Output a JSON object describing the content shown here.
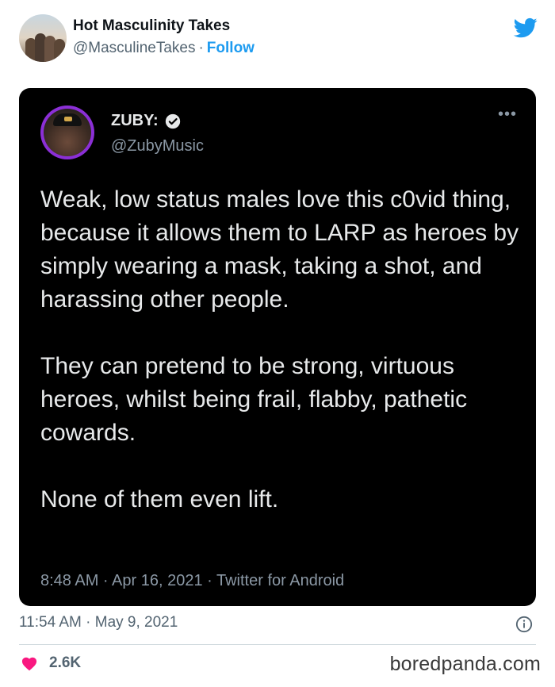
{
  "author": {
    "name": "Hot Masculinity Takes",
    "handle": "@MasculineTakes",
    "separator": "·",
    "follow_label": "Follow"
  },
  "quoted_tweet": {
    "name": "ZUBY:",
    "handle": "@ZubyMusic",
    "more_label": "•••",
    "paragraphs": [
      "Weak, low status males love this c0vid thing, because it allows them to LARP as heroes by simply wearing a mask, taking a shot, and harassing other people.",
      "They can pretend to be strong, virtuous heroes, whilst being frail, flabby, pathetic cowards.",
      "None of them even lift."
    ],
    "meta": "8:48 AM · Apr 16, 2021 · Twitter for Android"
  },
  "timestamp": "11:54 AM · May 9, 2021",
  "likes": "2.6K",
  "watermark": "boredpanda.com",
  "icons": {
    "logo": "twitter-bird-icon",
    "verified": "verified-badge-icon",
    "info": "info-icon",
    "heart": "heart-icon"
  },
  "colors": {
    "accent": "#1d9bf0",
    "heart": "#f91880",
    "verified_avatar_ring": "#8b2fd6",
    "card_bg": "#000000"
  }
}
